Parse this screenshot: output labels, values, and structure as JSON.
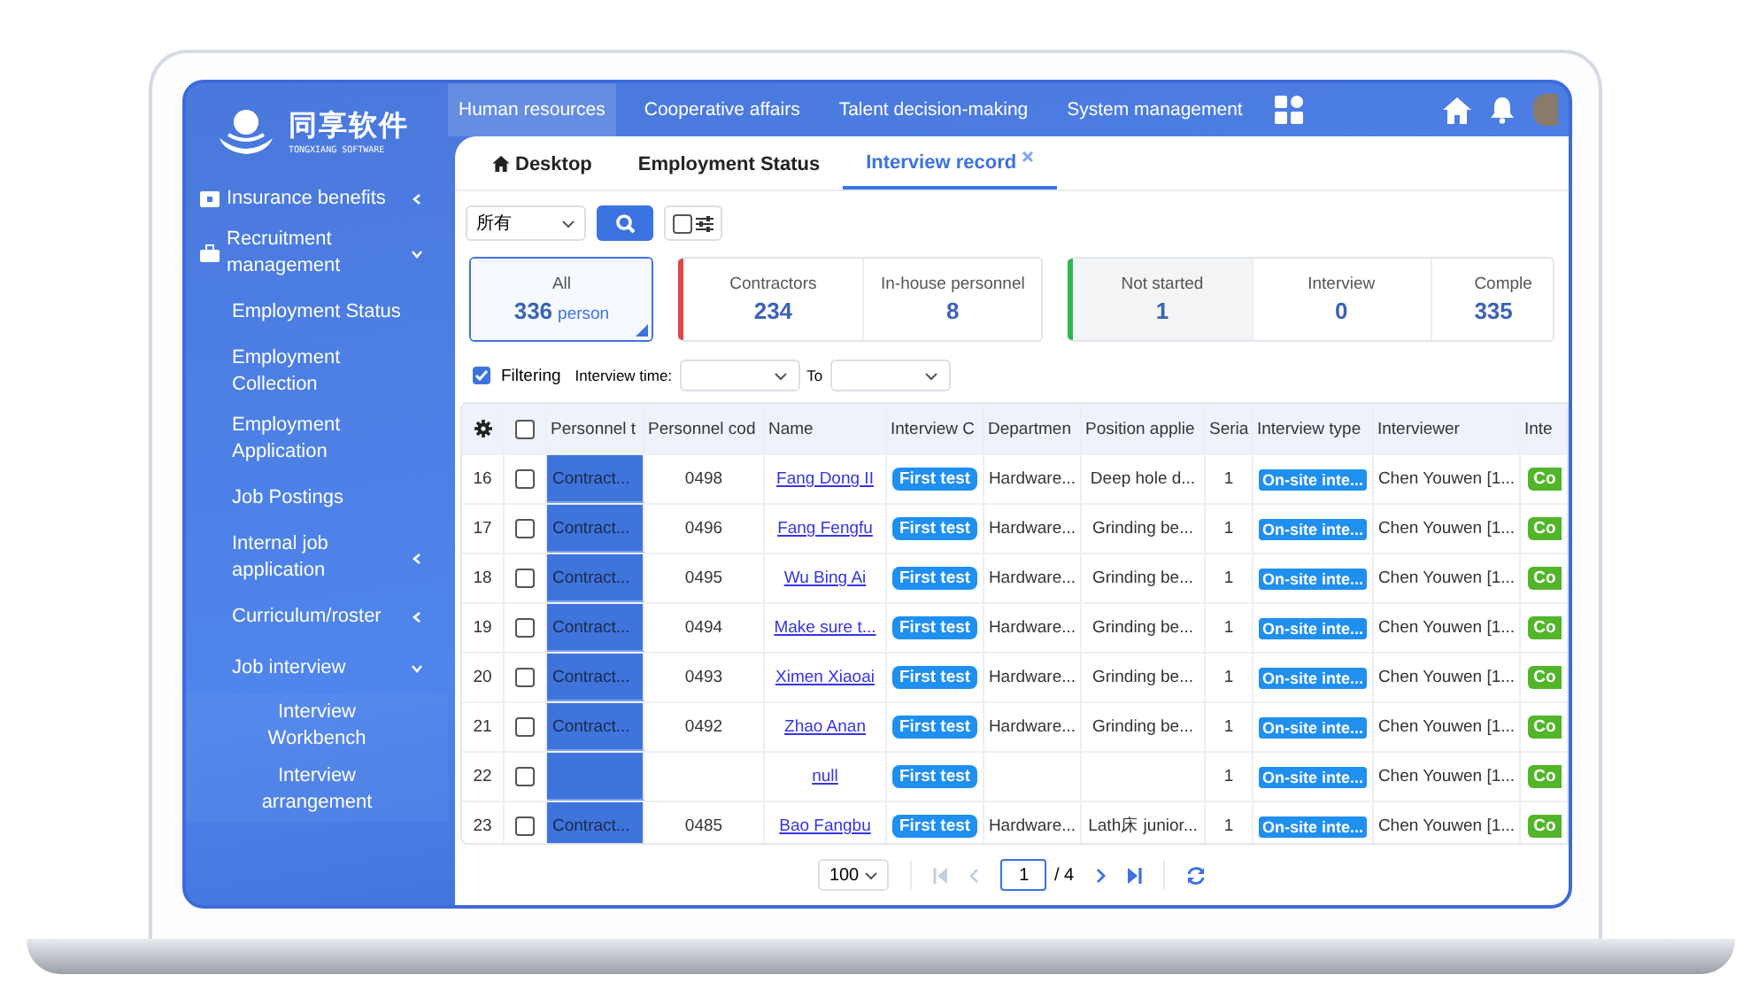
{
  "logo": {
    "title": "同享软件",
    "subtitle": "TONGXIANG SOFTWARE"
  },
  "nav": [
    {
      "label": "Human resources",
      "selected": true
    },
    {
      "label": "Cooperative affairs",
      "selected": false
    },
    {
      "label": "Talent decision-making",
      "selected": false
    },
    {
      "label": "System management",
      "selected": false
    }
  ],
  "sidebar": {
    "items": [
      {
        "label": "Insurance benefits",
        "expanded": false
      },
      {
        "label": "Recruitment management",
        "expanded": true,
        "children": [
          {
            "label": "Employment Status"
          },
          {
            "label": "Employment Collection"
          },
          {
            "label": "Employment Application"
          },
          {
            "label": "Job Postings"
          },
          {
            "label": "Internal job application",
            "expanded": false
          },
          {
            "label": "Curriculum/roster",
            "expanded": false
          },
          {
            "label": "Job interview",
            "expanded": true,
            "children": [
              {
                "label": "Interview Workbench"
              },
              {
                "label": "Interview arrangement"
              }
            ]
          }
        ]
      }
    ]
  },
  "tabs": [
    {
      "label": "Desktop",
      "selected": false,
      "closable": false
    },
    {
      "label": "Employment Status",
      "selected": false,
      "closable": false
    },
    {
      "label": "Interview record",
      "selected": true,
      "closable": true
    }
  ],
  "toolbar": {
    "select": "所有",
    "checked": false
  },
  "stat_groups": [
    {
      "color": "#3b73e0",
      "items": [
        {
          "label": "All",
          "value": "336",
          "unit": "person",
          "selected": true
        }
      ]
    },
    {
      "color": "#e04848",
      "items": [
        {
          "label": "Contractors",
          "value": "234",
          "selected": false
        },
        {
          "label": "In-house personnel",
          "value": "8",
          "selected": false
        }
      ]
    },
    {
      "color": "#2db84d",
      "items": [
        {
          "label": "Not started",
          "value": "1",
          "selected": true
        },
        {
          "label": "Interview",
          "value": "0",
          "selected": false
        },
        {
          "label": "Comple",
          "value": "335",
          "selected": false
        }
      ]
    }
  ],
  "filter": {
    "checked": true,
    "label": "Filtering",
    "time_label": "Interview time:",
    "to_label": "To"
  },
  "table": {
    "header_checked": false,
    "columns": [
      "Personnel t",
      "Personnel cod",
      "Name",
      "Interview C",
      "Departmen",
      "Position applie",
      "Seria",
      "Interview type",
      "Interviewer",
      "Inte"
    ],
    "rows": [
      {
        "index": "16",
        "checked": false,
        "type": "Contract...",
        "code": "0498",
        "name": "Fang Dong II",
        "round": "First test",
        "dept": "Hardware...",
        "position": "Deep hole d...",
        "serial": "1",
        "itype": "On-site inte...",
        "interviewer": "Chen Youwen [1...",
        "status": "Co"
      },
      {
        "index": "17",
        "checked": false,
        "type": "Contract...",
        "code": "0496",
        "name": "Fang Fengfu",
        "round": "First test",
        "dept": "Hardware...",
        "position": "Grinding be...",
        "serial": "1",
        "itype": "On-site inte...",
        "interviewer": "Chen Youwen [1...",
        "status": "Co"
      },
      {
        "index": "18",
        "checked": false,
        "type": "Contract...",
        "code": "0495",
        "name": "Wu Bing Ai",
        "round": "First test",
        "dept": "Hardware...",
        "position": "Grinding be...",
        "serial": "1",
        "itype": "On-site inte...",
        "interviewer": "Chen Youwen [1...",
        "status": "Co"
      },
      {
        "index": "19",
        "checked": false,
        "type": "Contract...",
        "code": "0494",
        "name": "Make sure t...",
        "round": "First test",
        "dept": "Hardware...",
        "position": "Grinding be...",
        "serial": "1",
        "itype": "On-site inte...",
        "interviewer": "Chen Youwen [1...",
        "status": "Co"
      },
      {
        "index": "20",
        "checked": false,
        "type": "Contract...",
        "code": "0493",
        "name": "Ximen Xiaoai",
        "round": "First test",
        "dept": "Hardware...",
        "position": "Grinding be...",
        "serial": "1",
        "itype": "On-site inte...",
        "interviewer": "Chen Youwen [1...",
        "status": "Co"
      },
      {
        "index": "21",
        "checked": false,
        "type": "Contract...",
        "code": "0492",
        "name": "Zhao Anan",
        "round": "First test",
        "dept": "Hardware...",
        "position": "Grinding be...",
        "serial": "1",
        "itype": "On-site inte...",
        "interviewer": "Chen Youwen [1...",
        "status": "Co"
      },
      {
        "index": "22",
        "checked": false,
        "name": "null",
        "round": "First test",
        "serial": "1",
        "itype": "On-site inte...",
        "interviewer": "Chen Youwen [1...",
        "status": "Co"
      },
      {
        "index": "23",
        "checked": false,
        "type": "Contract...",
        "code": "0485",
        "name": "Bao Fangbu",
        "round": "First test",
        "dept": "Hardware...",
        "position": "Lath床 junior...",
        "serial": "1",
        "itype": "On-site inte...",
        "interviewer": "Chen Youwen [1...",
        "status": "Co"
      }
    ]
  },
  "pagination": {
    "page_size": "100",
    "page": "1",
    "total": "/ 4"
  }
}
